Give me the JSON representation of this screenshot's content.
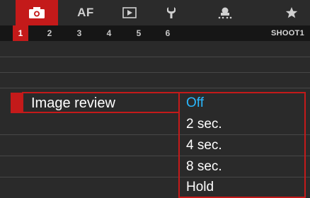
{
  "categories": [
    {
      "name": "shooting",
      "icon": "camera-icon",
      "active": true
    },
    {
      "name": "autofocus",
      "label": "AF"
    },
    {
      "name": "playback",
      "icon": "playback-icon"
    },
    {
      "name": "setup",
      "icon": "wrench-icon"
    },
    {
      "name": "custom-functions",
      "icon": "custom-function-icon"
    },
    {
      "name": "my-menu",
      "icon": "star-icon"
    }
  ],
  "tabs": [
    "1",
    "2",
    "3",
    "4",
    "5",
    "6"
  ],
  "active_tab": "1",
  "screen_title": "SHOOT1",
  "menu": {
    "item_label": "Image review",
    "options": [
      "Off",
      "2 sec.",
      "4 sec.",
      "8 sec.",
      "Hold"
    ],
    "selected_option": "Off"
  },
  "colors": {
    "accent": "#c41a1a",
    "selected_text": "#29b8ff",
    "background": "#2a2a2a"
  }
}
